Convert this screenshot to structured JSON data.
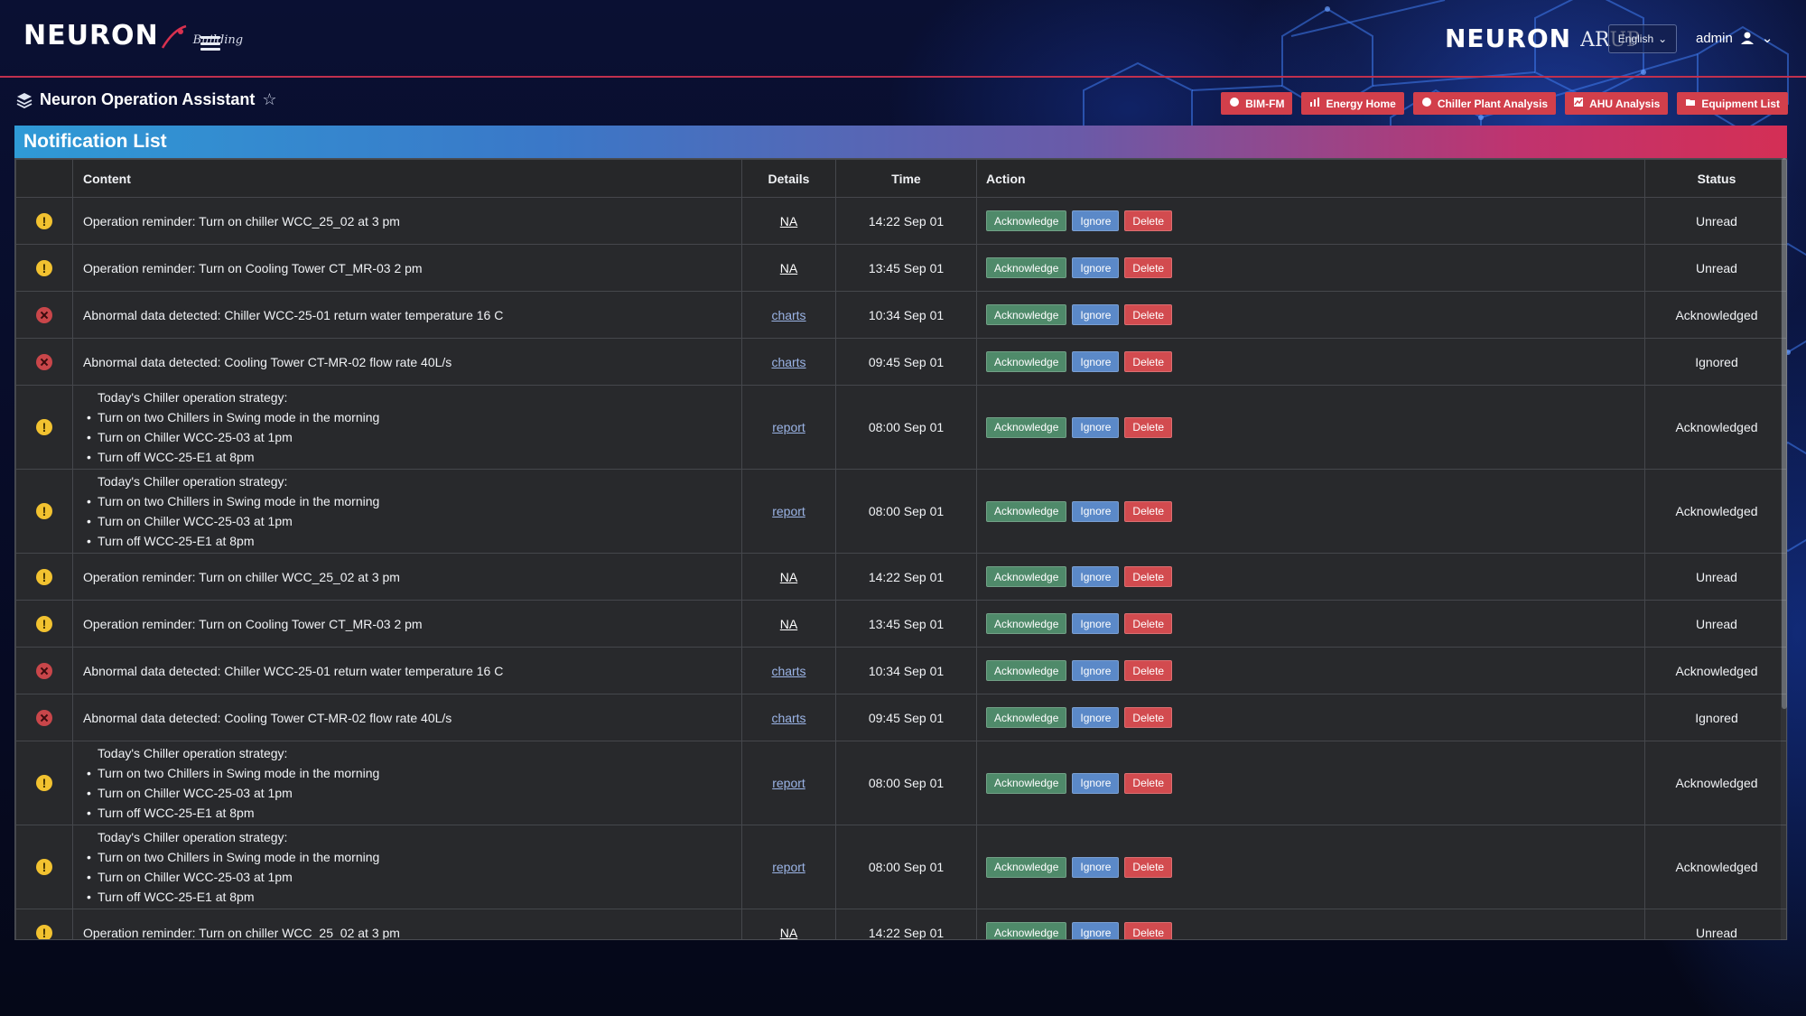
{
  "brand": {
    "logo_text": "NEURON",
    "logo_sub": "Building",
    "partner_logo_text": "NEURON",
    "partner_name": "ARUP"
  },
  "header": {
    "language": "English",
    "user": "admin"
  },
  "page": {
    "title": "Neuron Operation Assistant"
  },
  "nav": [
    {
      "label": "BIM-FM",
      "icon": "globe-icon"
    },
    {
      "label": "Energy Home",
      "icon": "bar-chart-icon"
    },
    {
      "label": "Chiller Plant Analysis",
      "icon": "globe-icon"
    },
    {
      "label": "AHU Analysis",
      "icon": "chart-icon"
    },
    {
      "label": "Equipment List",
      "icon": "folder-icon"
    }
  ],
  "panel": {
    "title": "Notification List"
  },
  "table": {
    "headers": {
      "content": "Content",
      "details": "Details",
      "time": "Time",
      "action": "Action",
      "status": "Status"
    },
    "action_labels": {
      "acknowledge": "Acknowledge",
      "ignore": "Ignore",
      "delete": "Delete"
    },
    "rows": [
      {
        "severity": "warning",
        "content": "Operation reminder: Turn on chiller WCC_25_02 at 3 pm",
        "details": "NA",
        "time": "14:22 Sep 01",
        "status": "Unread"
      },
      {
        "severity": "warning",
        "content": "Operation reminder: Turn on Cooling Tower CT_MR-03 2 pm",
        "details": "NA",
        "time": "13:45 Sep 01",
        "status": "Unread"
      },
      {
        "severity": "error",
        "content": "Abnormal data detected: Chiller WCC-25-01 return water temperature 16 C",
        "details": "charts",
        "time": "10:34 Sep 01",
        "status": "Acknowledged"
      },
      {
        "severity": "error",
        "content": "Abnormal data detected: Cooling Tower CT-MR-02 flow rate 40L/s",
        "details": "charts",
        "time": "09:45 Sep 01",
        "status": "Ignored"
      },
      {
        "severity": "warning",
        "heading": "Today's Chiller operation strategy:",
        "bullets": [
          "Turn on two Chillers in Swing mode in the morning",
          "Turn on Chiller WCC-25-03 at 1pm",
          "Turn off WCC-25-E1 at 8pm"
        ],
        "details": "report",
        "time": "08:00 Sep 01",
        "status": "Acknowledged"
      },
      {
        "severity": "warning",
        "heading": "Today's Chiller operation strategy:",
        "bullets": [
          "Turn on two Chillers in Swing mode in the morning",
          "Turn on Chiller WCC-25-03 at 1pm",
          "Turn off WCC-25-E1 at 8pm"
        ],
        "details": "report",
        "time": "08:00 Sep 01",
        "status": "Acknowledged"
      },
      {
        "severity": "warning",
        "content": "Operation reminder: Turn on chiller WCC_25_02 at 3 pm",
        "details": "NA",
        "time": "14:22 Sep 01",
        "status": "Unread"
      },
      {
        "severity": "warning",
        "content": "Operation reminder: Turn on Cooling Tower CT_MR-03 2 pm",
        "details": "NA",
        "time": "13:45 Sep 01",
        "status": "Unread"
      },
      {
        "severity": "error",
        "content": "Abnormal data detected: Chiller WCC-25-01 return water temperature 16 C",
        "details": "charts",
        "time": "10:34 Sep 01",
        "status": "Acknowledged"
      },
      {
        "severity": "error",
        "content": "Abnormal data detected: Cooling Tower CT-MR-02 flow rate 40L/s",
        "details": "charts",
        "time": "09:45 Sep 01",
        "status": "Ignored"
      },
      {
        "severity": "warning",
        "heading": "Today's Chiller operation strategy:",
        "bullets": [
          "Turn on two Chillers in Swing mode in the morning",
          "Turn on Chiller WCC-25-03 at 1pm",
          "Turn off WCC-25-E1 at 8pm"
        ],
        "details": "report",
        "time": "08:00 Sep 01",
        "status": "Acknowledged"
      },
      {
        "severity": "warning",
        "heading": "Today's Chiller operation strategy:",
        "bullets": [
          "Turn on two Chillers in Swing mode in the morning",
          "Turn on Chiller WCC-25-03 at 1pm",
          "Turn off WCC-25-E1 at 8pm"
        ],
        "details": "report",
        "time": "08:00 Sep 01",
        "status": "Acknowledged"
      },
      {
        "severity": "warning",
        "content": "Operation reminder: Turn on chiller WCC_25_02 at 3 pm",
        "details": "NA",
        "time": "14:22 Sep 01",
        "status": "Unread"
      }
    ]
  },
  "colors": {
    "nav_button": "#d23f4b",
    "acknowledge": "#4f8a6a",
    "ignore": "#5b89c8",
    "delete": "#d24b4f",
    "warning": "#f2c230",
    "error": "#c9464a"
  }
}
